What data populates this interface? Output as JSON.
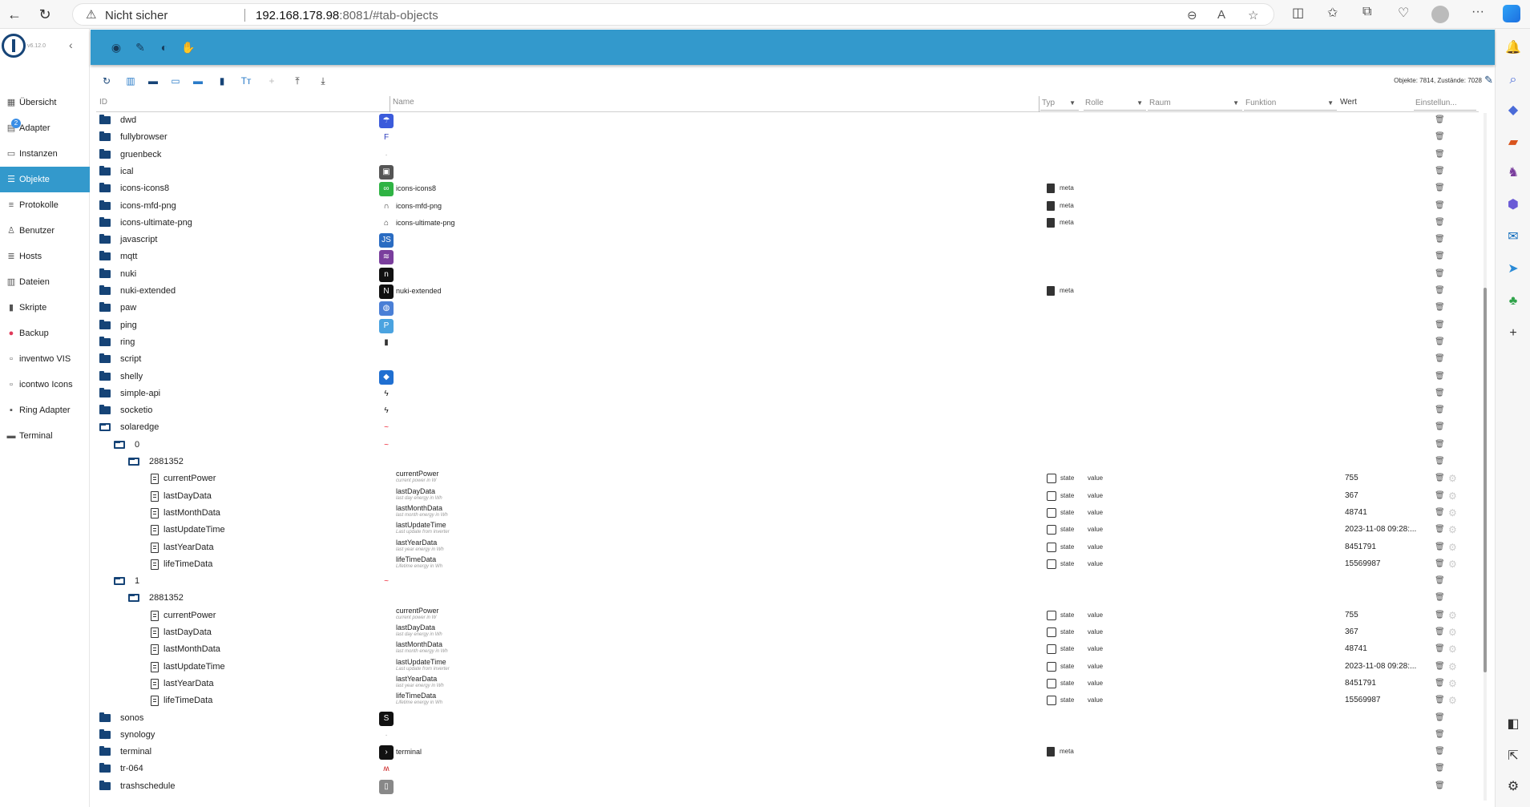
{
  "browser": {
    "insecure_label": "Nicht sicher",
    "url_host": "192.168.178.98",
    "url_rest": ":8081/#tab-objects"
  },
  "app": {
    "version": "v6.12.0",
    "nav": [
      {
        "label": "Übersicht",
        "icon": "grid-icon",
        "glyph": "▦",
        "active": false
      },
      {
        "label": "Adapter",
        "icon": "adapter-icon",
        "glyph": "▤",
        "active": false,
        "badge": "2"
      },
      {
        "label": "Instanzen",
        "icon": "instances-icon",
        "glyph": "▭",
        "active": false
      },
      {
        "label": "Objekte",
        "icon": "objects-icon",
        "glyph": "☰",
        "active": true
      },
      {
        "label": "Protokolle",
        "icon": "logs-icon",
        "glyph": "≡",
        "active": false
      },
      {
        "label": "Benutzer",
        "icon": "user-icon",
        "glyph": "♙",
        "active": false
      },
      {
        "label": "Hosts",
        "icon": "hosts-icon",
        "glyph": "≣",
        "active": false
      },
      {
        "label": "Dateien",
        "icon": "files-icon",
        "glyph": "▥",
        "active": false
      },
      {
        "label": "Skripte",
        "icon": "scripts-icon",
        "glyph": "▮",
        "active": false
      },
      {
        "label": "Backup",
        "icon": "backup-icon",
        "glyph": "●",
        "active": false
      },
      {
        "label": "inventwo VIS",
        "icon": "inventwo-icon",
        "glyph": "▫",
        "active": false
      },
      {
        "label": "icontwo Icons",
        "icon": "icontwo-icon",
        "glyph": "▫",
        "active": false
      },
      {
        "label": "Ring Adapter",
        "icon": "ring-icon",
        "glyph": "▪",
        "active": false
      },
      {
        "label": "Terminal",
        "icon": "terminal-icon",
        "glyph": "▬",
        "active": false
      }
    ]
  },
  "objects": {
    "stats": "Objekte: 7814, Zustände: 7028",
    "columns": {
      "id": "ID",
      "name": "Name",
      "type": "Typ",
      "role": "Rolle",
      "room": "Raum",
      "function": "Funktion",
      "value": "Wert",
      "settings": "Einstellun..."
    },
    "rows": [
      {
        "id": "dwd",
        "level": 0,
        "kind": "folder",
        "icon_color": "#3b5bdb",
        "icon_glyph": "☂"
      },
      {
        "id": "fullybrowser",
        "level": 0,
        "kind": "folder",
        "icon_color": "#ffffff",
        "icon_glyph": "F",
        "icon_text": "#2d3dbd"
      },
      {
        "id": "gruenbeck",
        "level": 0,
        "kind": "folder",
        "icon_color": "#ffffff",
        "icon_glyph": "·",
        "icon_text": "#aaa"
      },
      {
        "id": "ical",
        "level": 0,
        "kind": "folder",
        "icon_color": "#555555",
        "icon_glyph": "▣"
      },
      {
        "id": "icons-icons8",
        "level": 0,
        "kind": "folder",
        "icon_color": "#2fb344",
        "icon_glyph": "∞",
        "name": "icons-icons8",
        "meta": "meta"
      },
      {
        "id": "icons-mfd-png",
        "level": 0,
        "kind": "folder",
        "icon_color": "#ffffff",
        "icon_glyph": "∩",
        "icon_text": "#333",
        "name": "icons-mfd-png",
        "meta": "meta"
      },
      {
        "id": "icons-ultimate-png",
        "level": 0,
        "kind": "folder",
        "icon_color": "#ffffff",
        "icon_glyph": "⌂",
        "icon_text": "#333",
        "name": "icons-ultimate-png",
        "meta": "meta"
      },
      {
        "id": "javascript",
        "level": 0,
        "kind": "folder",
        "icon_color": "#2a6cc2",
        "icon_glyph": "JS"
      },
      {
        "id": "mqtt",
        "level": 0,
        "kind": "folder",
        "icon_color": "#7a3e9d",
        "icon_glyph": "≋"
      },
      {
        "id": "nuki",
        "level": 0,
        "kind": "folder",
        "icon_color": "#111111",
        "icon_glyph": "n"
      },
      {
        "id": "nuki-extended",
        "level": 0,
        "kind": "folder",
        "icon_color": "#111111",
        "icon_glyph": "N",
        "name": "nuki-extended",
        "meta": "meta"
      },
      {
        "id": "paw",
        "level": 0,
        "kind": "folder",
        "icon_color": "#4a7fd6",
        "icon_glyph": "◍"
      },
      {
        "id": "ping",
        "level": 0,
        "kind": "folder",
        "icon_color": "#4aa3e0",
        "icon_glyph": "P"
      },
      {
        "id": "ring",
        "level": 0,
        "kind": "folder",
        "icon_color": "#ffffff",
        "icon_glyph": "▮",
        "icon_text": "#333"
      },
      {
        "id": "script",
        "level": 0,
        "kind": "folder"
      },
      {
        "id": "shelly",
        "level": 0,
        "kind": "folder",
        "icon_color": "#1f6fd1",
        "icon_glyph": "◆"
      },
      {
        "id": "simple-api",
        "level": 0,
        "kind": "folder",
        "icon_color": "#ffffff",
        "icon_glyph": "ϟ",
        "icon_text": "#111"
      },
      {
        "id": "socketio",
        "level": 0,
        "kind": "folder",
        "icon_color": "#ffffff",
        "icon_glyph": "ϟ",
        "icon_text": "#111"
      },
      {
        "id": "solaredge",
        "level": 0,
        "kind": "folder-open",
        "icon_color": "#ffffff",
        "icon_glyph": "~",
        "icon_text": "#e23"
      },
      {
        "id": "0",
        "level": 1,
        "kind": "folder-open",
        "icon_color": "#ffffff",
        "icon_glyph": "~",
        "icon_text": "#e23"
      },
      {
        "id": "2881352",
        "level": 2,
        "kind": "folder-open"
      },
      {
        "id": "currentPower",
        "level": 3,
        "kind": "state",
        "name": "currentPower",
        "desc": "current power in W",
        "type": "state",
        "role": "value",
        "value": "755"
      },
      {
        "id": "lastDayData",
        "level": 3,
        "kind": "state",
        "name": "lastDayData",
        "desc": "last day energy in Wh",
        "type": "state",
        "role": "value",
        "value": "367"
      },
      {
        "id": "lastMonthData",
        "level": 3,
        "kind": "state",
        "name": "lastMonthData",
        "desc": "last month energy in Wh",
        "type": "state",
        "role": "value",
        "value": "48741"
      },
      {
        "id": "lastUpdateTime",
        "level": 3,
        "kind": "state",
        "name": "lastUpdateTime",
        "desc": "Last update from inverter",
        "type": "state",
        "role": "value",
        "value": "2023-11-08 09:28:..."
      },
      {
        "id": "lastYearData",
        "level": 3,
        "kind": "state",
        "name": "lastYearData",
        "desc": "last year energy in Wh",
        "type": "state",
        "role": "value",
        "value": "8451791"
      },
      {
        "id": "lifeTimeData",
        "level": 3,
        "kind": "state",
        "name": "lifeTimeData",
        "desc": "Lifetime energy in Wh",
        "type": "state",
        "role": "value",
        "value": "15569987"
      },
      {
        "id": "1",
        "level": 1,
        "kind": "folder-open",
        "icon_color": "#ffffff",
        "icon_glyph": "~",
        "icon_text": "#e23"
      },
      {
        "id": "2881352",
        "level": 2,
        "kind": "folder-open"
      },
      {
        "id": "currentPower",
        "level": 3,
        "kind": "state",
        "name": "currentPower",
        "desc": "current power in W",
        "type": "state",
        "role": "value",
        "value": "755"
      },
      {
        "id": "lastDayData",
        "level": 3,
        "kind": "state",
        "name": "lastDayData",
        "desc": "last day energy in Wh",
        "type": "state",
        "role": "value",
        "value": "367"
      },
      {
        "id": "lastMonthData",
        "level": 3,
        "kind": "state",
        "name": "lastMonthData",
        "desc": "last month energy in Wh",
        "type": "state",
        "role": "value",
        "value": "48741"
      },
      {
        "id": "lastUpdateTime",
        "level": 3,
        "kind": "state",
        "name": "lastUpdateTime",
        "desc": "Last update from inverter",
        "type": "state",
        "role": "value",
        "value": "2023-11-08 09:28:..."
      },
      {
        "id": "lastYearData",
        "level": 3,
        "kind": "state",
        "name": "lastYearData",
        "desc": "last year energy in Wh",
        "type": "state",
        "role": "value",
        "value": "8451791"
      },
      {
        "id": "lifeTimeData",
        "level": 3,
        "kind": "state",
        "name": "lifeTimeData",
        "desc": "Lifetime energy in Wh",
        "type": "state",
        "role": "value",
        "value": "15569987"
      },
      {
        "id": "sonos",
        "level": 0,
        "kind": "folder",
        "icon_color": "#111111",
        "icon_glyph": "S"
      },
      {
        "id": "synology",
        "level": 0,
        "kind": "folder",
        "icon_color": "#ffffff",
        "icon_glyph": "·",
        "icon_text": "#aaa"
      },
      {
        "id": "terminal",
        "level": 0,
        "kind": "folder",
        "icon_color": "#111111",
        "icon_glyph": "›",
        "name": "terminal",
        "meta": "meta"
      },
      {
        "id": "tr-064",
        "level": 0,
        "kind": "folder",
        "icon_color": "#ffffff",
        "icon_glyph": "ʍ",
        "icon_text": "#c22"
      },
      {
        "id": "trashschedule",
        "level": 0,
        "kind": "folder",
        "icon_color": "#888888",
        "icon_glyph": "▯"
      }
    ]
  }
}
